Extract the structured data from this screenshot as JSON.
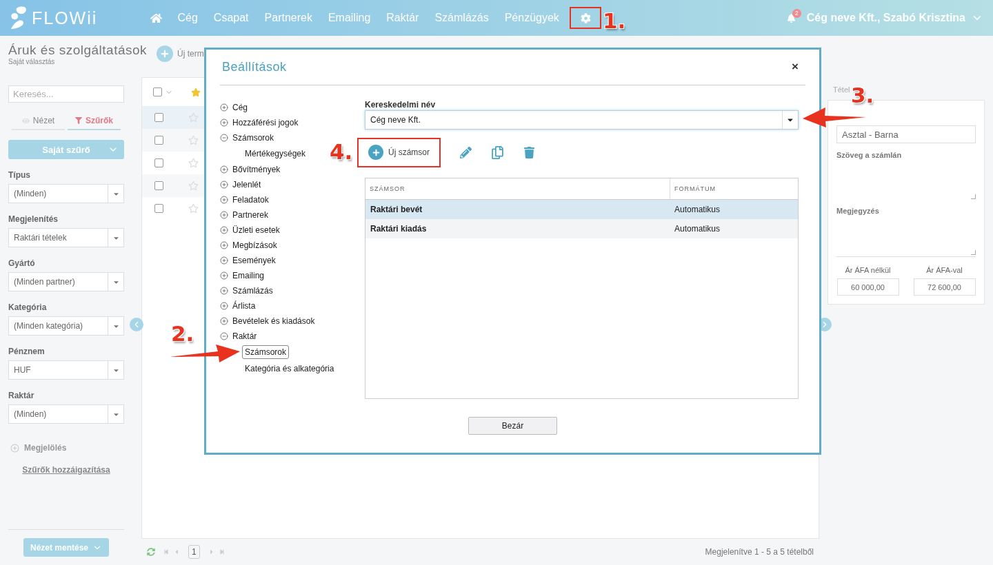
{
  "header": {
    "logo": "FLOWii",
    "nav": [
      {
        "label": "Cég"
      },
      {
        "label": "Csapat"
      },
      {
        "label": "Partnerek"
      },
      {
        "label": "Emailing"
      },
      {
        "label": "Raktár"
      },
      {
        "label": "Számlázás"
      },
      {
        "label": "Pénzügyek"
      }
    ],
    "settings_highlighted": true,
    "notifications": "2",
    "user": "Cég neve Kft., Szabó Krisztina"
  },
  "page": {
    "title": "Áruk és szolgáltatások",
    "subtitle": "Saját választás",
    "new_button": "Új term"
  },
  "sidebar": {
    "search_placeholder": "Keresés...",
    "tabs": [
      {
        "label": "Nézet",
        "selected": false
      },
      {
        "label": "Szűrők",
        "selected": true
      }
    ],
    "filter_button": "Saját szűrő",
    "filters": [
      {
        "label": "Típus",
        "value": "(Minden)"
      },
      {
        "label": "Megjelenítés",
        "value": "Raktári tételek"
      },
      {
        "label": "Gyártó",
        "value": "(Minden partner)"
      },
      {
        "label": "Kategória",
        "value": "(Minden kategória)"
      },
      {
        "label": "Pénznem",
        "value": "HUF"
      },
      {
        "label": "Raktár",
        "value": "(Minden)"
      }
    ],
    "mark": "Megjelölés",
    "adjust_link": "Szűrők hozzáigazítása",
    "save_button": "Nézet mentése"
  },
  "list": {
    "select_all": false,
    "star_filter": true,
    "rows": [
      {
        "checked": false,
        "starred": false,
        "selected": true
      },
      {
        "checked": false,
        "starred": false,
        "selected": false
      },
      {
        "checked": false,
        "starred": false,
        "selected": false
      },
      {
        "checked": false,
        "starred": false,
        "selected": false
      },
      {
        "checked": false,
        "starred": false,
        "selected": false
      }
    ],
    "page": "1",
    "summary": "Megjelenítve 1 - 5 a 5 tételből"
  },
  "detail": {
    "tab": "Tétel",
    "name": "Asztal - Barna",
    "invoice_text_label": "Szöveg a számlán",
    "note_label": "Megjegyzés",
    "price_net_label": "Ár ÁFA nélkül",
    "price_net": "60 000,00",
    "price_gross_label": "Ár ÁFA-val",
    "price_gross": "72 600,00"
  },
  "dialog": {
    "title": "Beállítások",
    "close": "×",
    "tree": [
      {
        "label": "Cég",
        "expanded": false
      },
      {
        "label": "Hozzáférési jogok",
        "expanded": false
      },
      {
        "label": "Számsorok",
        "expanded": true,
        "children": [
          {
            "label": "Mértékegységek",
            "selected": false
          }
        ]
      },
      {
        "label": "Bővítmények",
        "expanded": false
      },
      {
        "label": "Jelenlét",
        "expanded": false
      },
      {
        "label": "Feladatok",
        "expanded": false
      },
      {
        "label": "Partnerek",
        "expanded": false
      },
      {
        "label": "Üzleti esetek",
        "expanded": false
      },
      {
        "label": "Megbízások",
        "expanded": false
      },
      {
        "label": "Események",
        "expanded": false
      },
      {
        "label": "Emailing",
        "expanded": false
      },
      {
        "label": "Számlázás",
        "expanded": false
      },
      {
        "label": "Árlista",
        "expanded": false
      },
      {
        "label": "Bevételek és kiadások",
        "expanded": false
      },
      {
        "label": "Raktár",
        "expanded": true,
        "children": [
          {
            "label": "Számsorok",
            "selected": true
          },
          {
            "label": "Kategória és alkategória",
            "selected": false
          }
        ]
      }
    ],
    "field_label": "Kereskedelmi név",
    "field_value": "Cég neve Kft.",
    "new_button": {
      "label": "Új számsor",
      "highlighted": true
    },
    "table": {
      "columns": [
        "SZÁMSOR",
        "FORMÁTUM"
      ],
      "rows": [
        {
          "cells": [
            "Raktári bevét",
            "Automatikus"
          ],
          "selected": true
        },
        {
          "cells": [
            "Raktári kiadás",
            "Automatikus"
          ],
          "selected": false
        }
      ]
    },
    "close_button": "Bezár"
  },
  "annotations": [
    {
      "label": "1."
    },
    {
      "label": "2."
    },
    {
      "label": "3."
    },
    {
      "label": "4."
    }
  ]
}
